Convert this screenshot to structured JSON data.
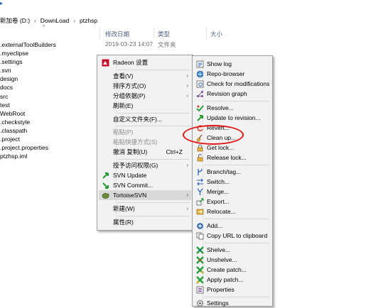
{
  "breadcrumb": {
    "items": [
      "新加卷 (D:)",
      "DownLoad",
      "ptzhsp"
    ],
    "separator": "›"
  },
  "columns": {
    "date_label": "修改日期",
    "type_label": "类型",
    "size_label": "大小",
    "sort_indicator": "^"
  },
  "files": [
    {
      "name": ".externalToolBuilders",
      "date": "2019-03-23 14:07",
      "type": "文件夹"
    },
    {
      "name": ".myeclipse"
    },
    {
      "name": ".settings"
    },
    {
      "name": ".svn"
    },
    {
      "name": "design"
    },
    {
      "name": "docs"
    },
    {
      "name": "src"
    },
    {
      "name": "test"
    },
    {
      "name": "WebRoot"
    },
    {
      "name": ".checkstyle"
    },
    {
      "name": ".classpath"
    },
    {
      "name": ".project"
    },
    {
      "name": ".project.properties"
    },
    {
      "name": "ptzhsp.iml"
    }
  ],
  "context_menu": {
    "items": [
      {
        "label": "Radeon 设置",
        "icon": "radeon-icon"
      },
      {
        "label": "查看(V)",
        "submenu": true
      },
      {
        "label": "排序方式(O)",
        "submenu": true
      },
      {
        "label": "分组依据(P)",
        "submenu": true
      },
      {
        "label": "刷新(E)"
      },
      {
        "label": "自定义文件夹(F)..."
      },
      {
        "label": "粘贴(P)",
        "disabled": true
      },
      {
        "label": "粘贴快捷方式(S)",
        "disabled": true
      },
      {
        "label": "撤消 复制(U)",
        "shortcut": "Ctrl+Z"
      },
      {
        "label": "授予访问权限(G)",
        "submenu": true
      },
      {
        "label": "SVN Update",
        "icon": "svn-update-icon"
      },
      {
        "label": "SVN Commit...",
        "icon": "svn-commit-icon"
      },
      {
        "label": "TortoiseSVN",
        "icon": "tortoisesvn-icon",
        "submenu": true,
        "highlighted": true
      },
      {
        "label": "新建(W)",
        "submenu": true
      },
      {
        "label": "属性(R)"
      }
    ]
  },
  "svn_menu": {
    "items": [
      {
        "label": "Show log",
        "icon": "show-log-icon"
      },
      {
        "label": "Repo-browser",
        "icon": "repo-browser-icon"
      },
      {
        "label": "Check for modifications",
        "icon": "check-modifications-icon"
      },
      {
        "label": "Revision graph",
        "icon": "revision-graph-icon"
      },
      {
        "label": "Resolve...",
        "icon": "resolve-icon"
      },
      {
        "label": "Update to revision...",
        "icon": "update-revision-icon"
      },
      {
        "label": "Revert...",
        "icon": "revert-icon"
      },
      {
        "label": "Clean up...",
        "icon": "cleanup-icon"
      },
      {
        "label": "Get lock...",
        "icon": "get-lock-icon"
      },
      {
        "label": "Release lock...",
        "icon": "release-lock-icon"
      },
      {
        "label": "Branch/tag...",
        "icon": "branch-tag-icon"
      },
      {
        "label": "Switch...",
        "icon": "switch-icon"
      },
      {
        "label": "Merge...",
        "icon": "merge-icon"
      },
      {
        "label": "Export...",
        "icon": "export-icon"
      },
      {
        "label": "Relocate...",
        "icon": "relocate-icon"
      },
      {
        "label": "Add...",
        "icon": "add-icon"
      },
      {
        "label": "Copy URL to clipboard",
        "icon": "copy-url-icon"
      },
      {
        "label": "Shelve...",
        "icon": "shelve-icon"
      },
      {
        "label": "Unshelve...",
        "icon": "unshelve-icon"
      },
      {
        "label": "Create patch...",
        "icon": "create-patch-icon"
      },
      {
        "label": "Apply patch...",
        "icon": "apply-patch-icon"
      },
      {
        "label": "Properties",
        "icon": "properties-icon"
      },
      {
        "label": "Settings",
        "icon": "settings-icon"
      }
    ]
  },
  "colors": {
    "highlight_ellipse": "#e01515",
    "menu_background": "#f2f2f2",
    "menu_hover": "#d9d9d9"
  }
}
